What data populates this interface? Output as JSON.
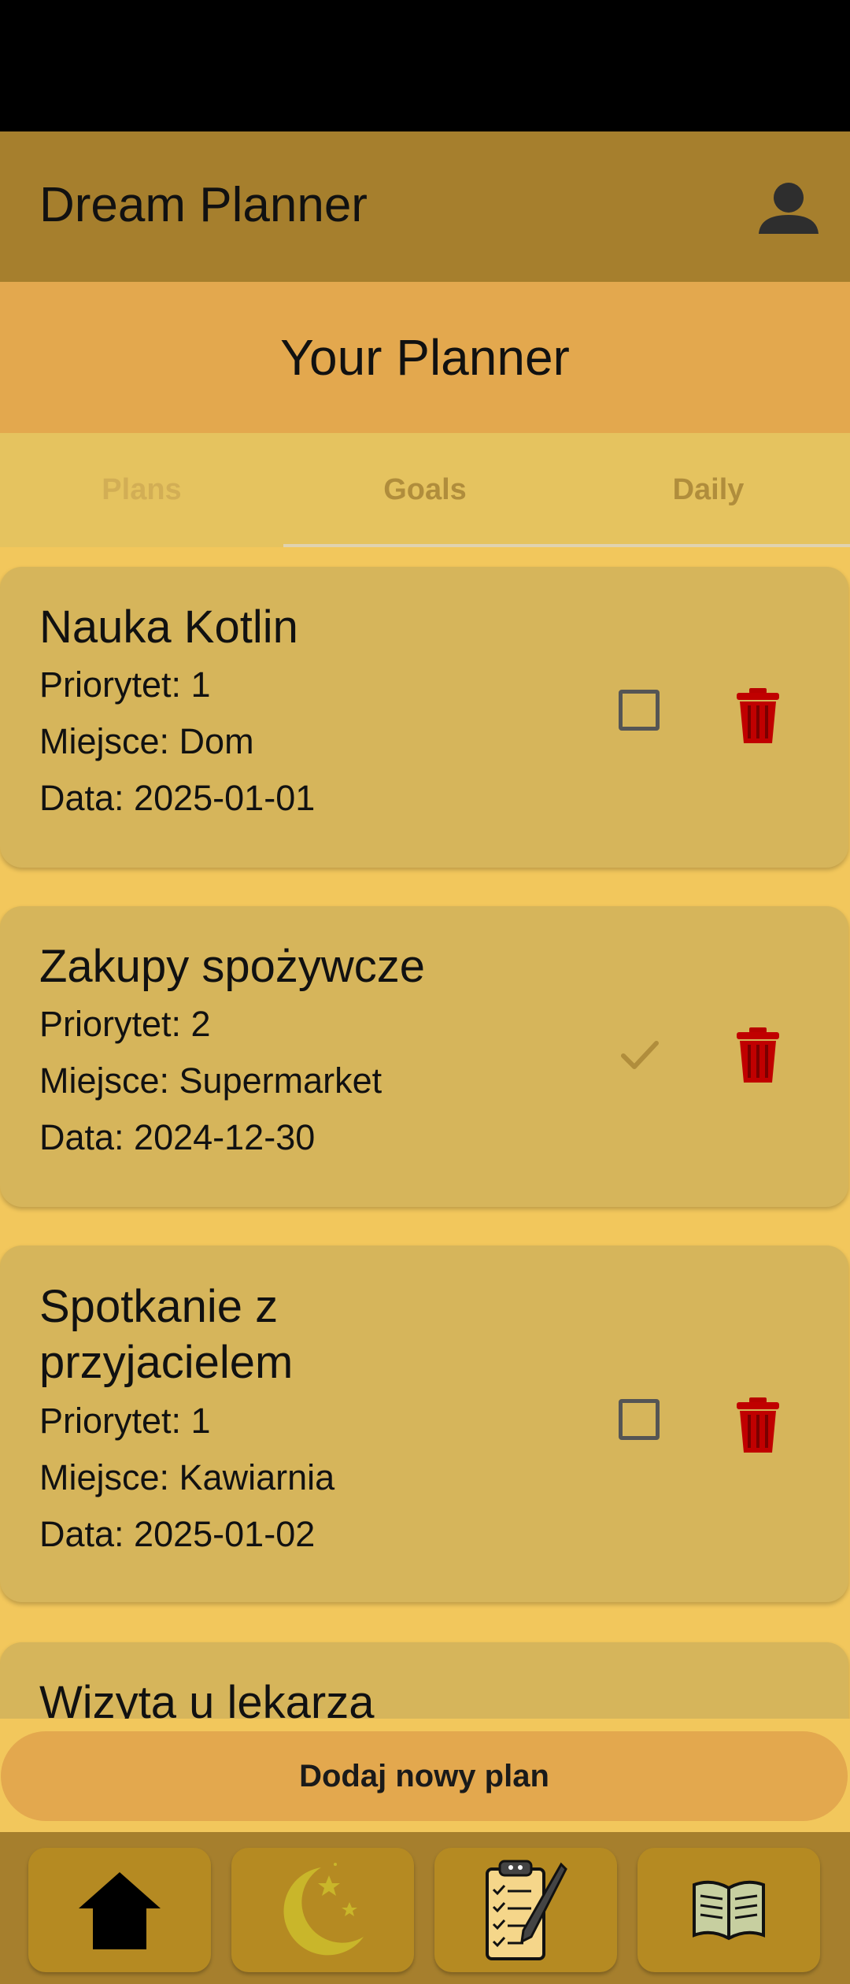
{
  "app": {
    "title": "Dream Planner"
  },
  "header": {
    "title": "Your Planner"
  },
  "tabs": [
    {
      "label": "Plans"
    },
    {
      "label": "Goals"
    },
    {
      "label": "Daily"
    }
  ],
  "plans": [
    {
      "title": "Nauka Kotlin",
      "priority": "Priorytet: 1",
      "place": "Miejsce: Dom",
      "date": "Data: 2025-01-01",
      "done": false
    },
    {
      "title": "Zakupy spożywcze",
      "priority": "Priorytet: 2",
      "place": "Miejsce: Supermarket",
      "date": "Data: 2024-12-30",
      "done": true
    },
    {
      "title_line1": "Spotkanie z",
      "title_line2": "przyjacielem",
      "priority": "Priorytet: 1",
      "place": "Miejsce: Kawiarnia",
      "date": "Data: 2025-01-02",
      "done": false
    },
    {
      "title": "Wizyta u lekarza"
    }
  ],
  "add_button": {
    "label": "Dodaj nowy plan"
  },
  "bottom_nav": [
    "home-icon",
    "moon-stars-icon",
    "clipboard-checklist-icon",
    "open-book-icon"
  ],
  "colors": {
    "app_bar": "#A67F2D",
    "header": "#E3A84E",
    "card": "#D6B55B",
    "background": "#F2C75C",
    "trash": "#C00000"
  }
}
